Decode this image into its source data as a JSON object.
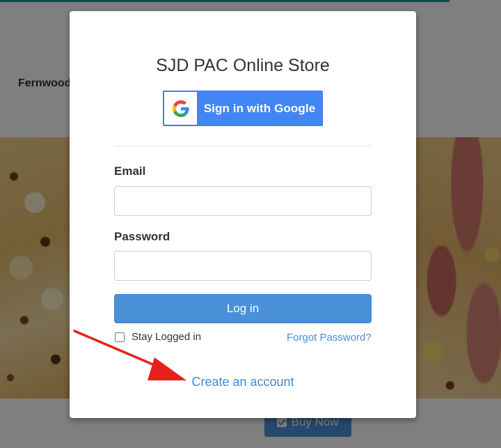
{
  "background": {
    "store_name": "Fernwood",
    "buy_button_label": "Buy Now"
  },
  "modal": {
    "title": "SJD PAC Online Store",
    "google_button_label": "Sign in with Google",
    "email_label": "Email",
    "email_value": "",
    "password_label": "Password",
    "password_value": "",
    "login_button_label": "Log in",
    "stay_logged_in_label": "Stay Logged in",
    "stay_logged_in_checked": false,
    "forgot_password_label": "Forgot Password?",
    "create_account_label": "Create an account"
  },
  "icons": {
    "google": "google-g-icon",
    "checkbox": "checkbox-checked-icon"
  },
  "colors": {
    "accent": "#4a90d9",
    "google_blue": "#4285f4",
    "link": "#3d8bd6",
    "annotation_arrow": "#e8201d",
    "header_bar": "#1f9a95"
  }
}
